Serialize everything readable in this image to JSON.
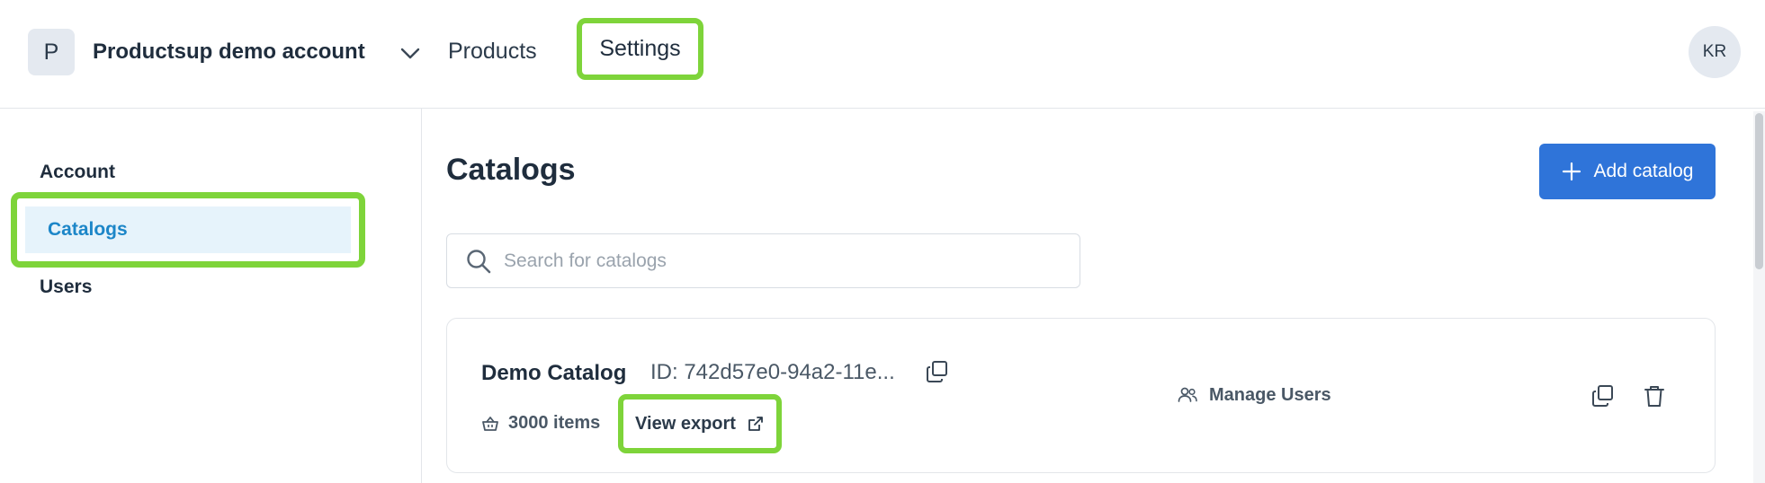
{
  "header": {
    "account_initial": "P",
    "account_name": "Productsup demo account",
    "nav": {
      "products": "Products",
      "settings": "Settings"
    },
    "user_initials": "KR"
  },
  "sidebar": {
    "items": [
      {
        "label": "Account",
        "active": false
      },
      {
        "label": "Catalogs",
        "active": true
      },
      {
        "label": "Users",
        "active": false
      }
    ]
  },
  "main": {
    "title": "Catalogs",
    "add_button_label": "Add catalog",
    "search": {
      "placeholder": "Search for catalogs",
      "value": ""
    },
    "catalogs": [
      {
        "name": "Demo Catalog",
        "id_text": "ID: 742d57e0-94a2-11e...",
        "items_text": "3000 items",
        "view_export_label": "View export",
        "manage_users_label": "Manage Users"
      }
    ]
  },
  "icons": {
    "chevron": "chevron-down-icon",
    "search": "search-icon",
    "plus": "plus-icon",
    "copy": "copy-icon",
    "basket": "basket-icon",
    "external": "external-link-icon",
    "users": "users-icon",
    "trash": "trash-icon"
  },
  "colors": {
    "highlight": "#7ed43a",
    "primary": "#2f74d9",
    "active_bg": "#e6f3fb",
    "active_text": "#1c86c8"
  }
}
